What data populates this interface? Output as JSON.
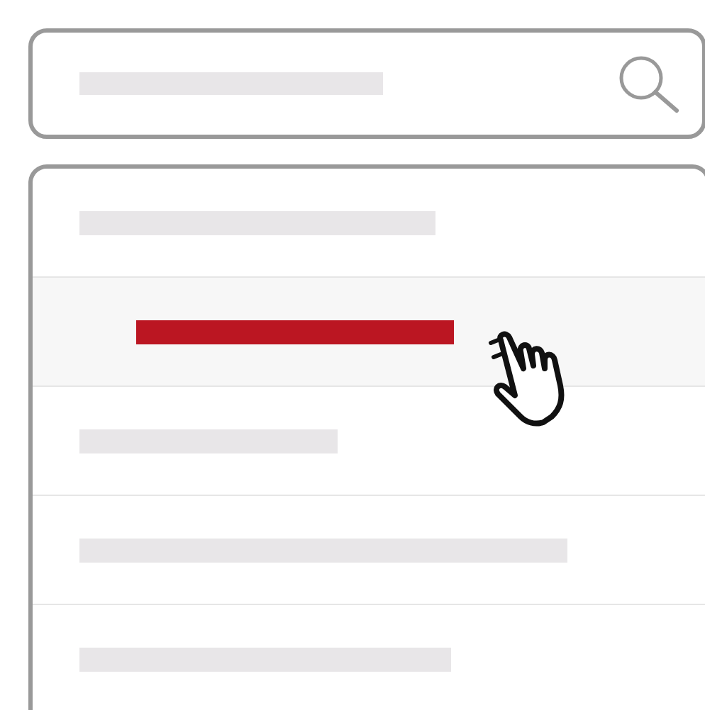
{
  "search": {
    "kind": "placeholder-bar"
  },
  "results": [
    {
      "selected": false
    },
    {
      "selected": true
    },
    {
      "selected": false
    },
    {
      "selected": false
    },
    {
      "selected": false
    }
  ]
}
